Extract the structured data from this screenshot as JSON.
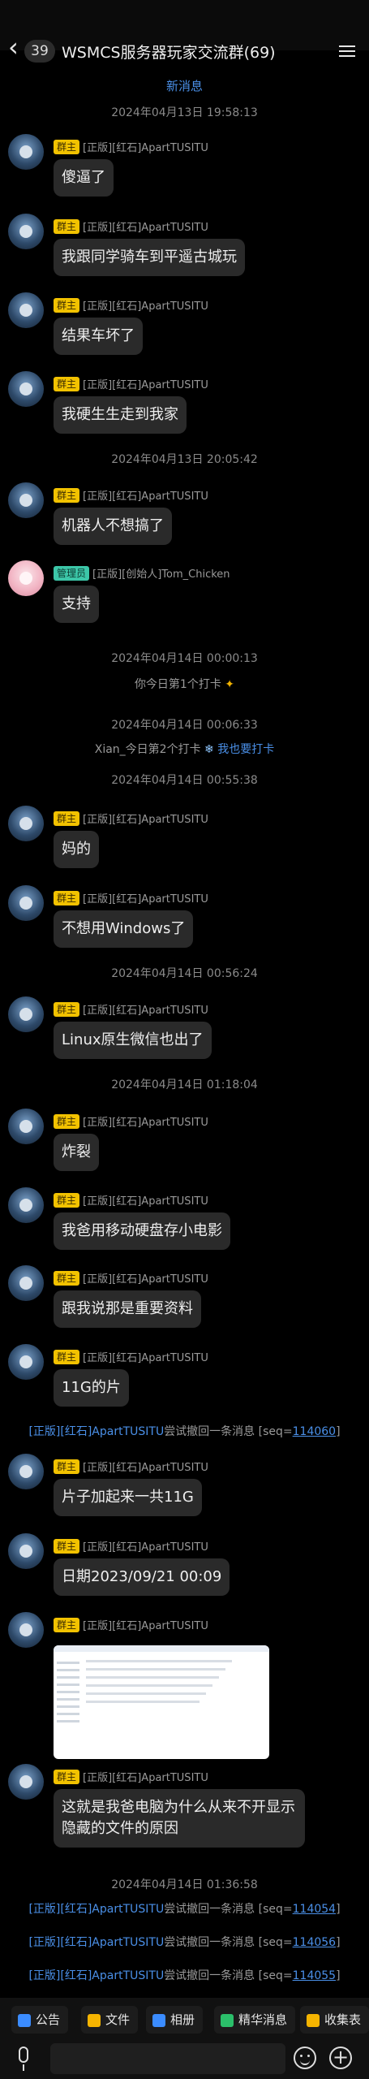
{
  "header": {
    "unread_count": "39",
    "title": "WSMCS服务器玩家交流群(69)"
  },
  "new_messages_label": "新消息",
  "timeline": [
    {
      "kind": "time",
      "text": "2024年04月13日 19:58:13"
    },
    {
      "kind": "msg",
      "badge": "群主",
      "nick": "[正版][红石]ApartTUSITU",
      "text": "傻逼了"
    },
    {
      "kind": "msg",
      "badge": "群主",
      "nick": "[正版][红石]ApartTUSITU",
      "text": "我跟同学骑车到平遥古城玩"
    },
    {
      "kind": "msg",
      "badge": "群主",
      "nick": "[正版][红石]ApartTUSITU",
      "text": "结果车坏了"
    },
    {
      "kind": "msg",
      "badge": "群主",
      "nick": "[正版][红石]ApartTUSITU",
      "text": "我硬生生走到我家"
    },
    {
      "kind": "time",
      "text": "2024年04月13日 20:05:42"
    },
    {
      "kind": "msg",
      "badge": "群主",
      "nick": "[正版][红石]ApartTUSITU",
      "text": "机器人不想搞了"
    },
    {
      "kind": "msg",
      "badge": "管理员",
      "nick": "[正版][创始人]Tom_Chicken",
      "text": "支持"
    },
    {
      "kind": "time",
      "text": "2024年04月14日 00:00:13"
    },
    {
      "kind": "checkin",
      "text": "你今日第1个打卡"
    },
    {
      "kind": "time",
      "text": "2024年04月14日 00:06:33"
    },
    {
      "kind": "checkin2",
      "text": "Xian_今日第2个打卡",
      "link": "我也要打卡"
    },
    {
      "kind": "time",
      "text": "2024年04月14日 00:55:38"
    },
    {
      "kind": "msg",
      "badge": "群主",
      "nick": "[正版][红石]ApartTUSITU",
      "text": "妈的"
    },
    {
      "kind": "msg",
      "badge": "群主",
      "nick": "[正版][红石]ApartTUSITU",
      "text": "不想用Windows了"
    },
    {
      "kind": "time",
      "text": "2024年04月14日 00:56:24"
    },
    {
      "kind": "msg",
      "badge": "群主",
      "nick": "[正版][红石]ApartTUSITU",
      "text": "Linux原生微信也出了"
    },
    {
      "kind": "time",
      "text": "2024年04月14日 01:18:04"
    },
    {
      "kind": "msg",
      "badge": "群主",
      "nick": "[正版][红石]ApartTUSITU",
      "text": "炸裂"
    },
    {
      "kind": "msg",
      "badge": "群主",
      "nick": "[正版][红石]ApartTUSITU",
      "text": "我爸用移动硬盘存小电影"
    },
    {
      "kind": "msg",
      "badge": "群主",
      "nick": "[正版][红石]ApartTUSITU",
      "text": "跟我说那是重要资料"
    },
    {
      "kind": "msg",
      "badge": "群主",
      "nick": "[正版][红石]ApartTUSITU",
      "text": "11G的片"
    },
    {
      "kind": "recall",
      "name": "[正版][红石]ApartTUSITU",
      "action": "尝试撤回一条消息",
      "seq_prefix": "[seq=",
      "seq": "114060",
      "seq_suffix": "]"
    },
    {
      "kind": "msg",
      "badge": "群主",
      "nick": "[正版][红石]ApartTUSITU",
      "text": "片子加起来一共11G"
    },
    {
      "kind": "msg",
      "badge": "群主",
      "nick": "[正版][红石]ApartTUSITU",
      "text": "日期2023/09/21 00:09"
    },
    {
      "kind": "image",
      "badge": "群主",
      "nick": "[正版][红石]ApartTUSITU"
    },
    {
      "kind": "msg",
      "badge": "群主",
      "nick": "[正版][红石]ApartTUSITU",
      "text": "这就是我爸电脑为什么从来不开显示隐藏的文件的原因",
      "wrap": true
    },
    {
      "kind": "time",
      "text": "2024年04月14日 01:36:58"
    },
    {
      "kind": "recall",
      "name": "[正版][红石]ApartTUSITU",
      "action": "尝试撤回一条消息",
      "seq_prefix": "[seq=",
      "seq": "114054",
      "seq_suffix": "]"
    },
    {
      "kind": "recall",
      "name": "[正版][红石]ApartTUSITU",
      "action": "尝试撤回一条消息",
      "seq_prefix": "[seq=",
      "seq": "114056",
      "seq_suffix": "]"
    },
    {
      "kind": "recall",
      "name": "[正版][红石]ApartTUSITU",
      "action": "尝试撤回一条消息",
      "seq_prefix": "[seq=",
      "seq": "114055",
      "seq_suffix": "]"
    }
  ],
  "toolbar": {
    "items": [
      {
        "label": "公告",
        "icon": "announcement-icon",
        "color": "#3b8cff"
      },
      {
        "label": "文件",
        "icon": "folder-icon",
        "color": "#f5b400"
      },
      {
        "label": "相册",
        "icon": "album-icon",
        "color": "#3b8cff"
      },
      {
        "label": "精华消息",
        "icon": "essence-icon",
        "color": "#2bbf6a"
      },
      {
        "label": "收集表",
        "icon": "form-icon",
        "color": "#f5b400"
      }
    ]
  },
  "colors": {
    "link": "#4a8fe7",
    "owner_badge": "#f2c200",
    "admin_badge": "#3cc6a8",
    "bubble": "#2a2a2a"
  }
}
